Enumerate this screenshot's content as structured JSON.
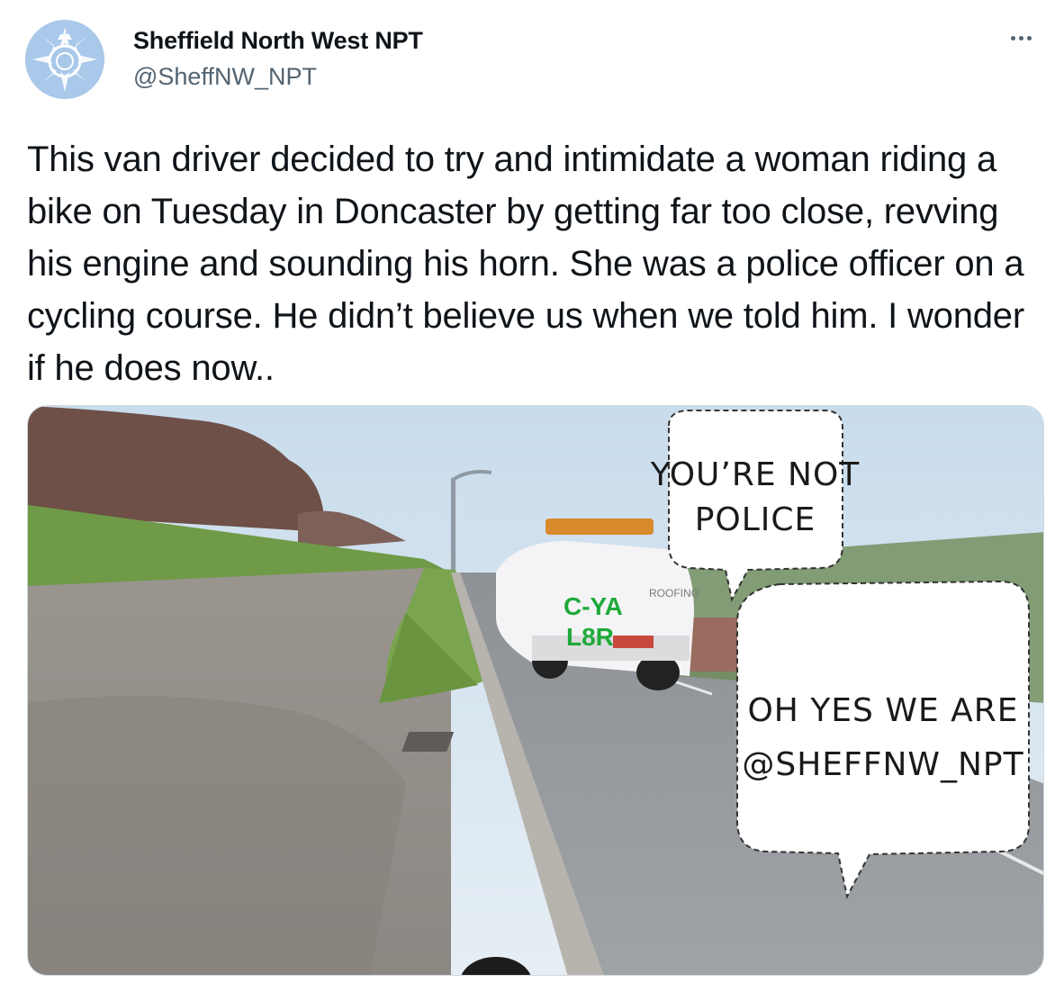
{
  "account": {
    "display_name": "Sheffield North West NPT",
    "handle": "@SheffNW_NPT",
    "avatar_icon": "police-crest-icon"
  },
  "tweet": {
    "text": "This van driver decided to try and intimidate a woman riding a bike on Tuesday in Doncaster by getting far too close, revving his engine and sounding his horn. She was a police officer on a cycling course. He didn’t believe us when we told him. I wonder if he does now.."
  },
  "media": {
    "bubble_top_line1": "YOU’RE NOT",
    "bubble_top_line2": "POLICE",
    "bubble_bottom_line1": "OH YES WE ARE",
    "bubble_bottom_line2": "@SHEFFNW_NPT",
    "van_text_line1": "C-YA",
    "van_text_line2": "L8R",
    "van_brand": "ROOFING"
  },
  "colors": {
    "accent_green": "#1faa3a",
    "muted_text": "#536471"
  }
}
